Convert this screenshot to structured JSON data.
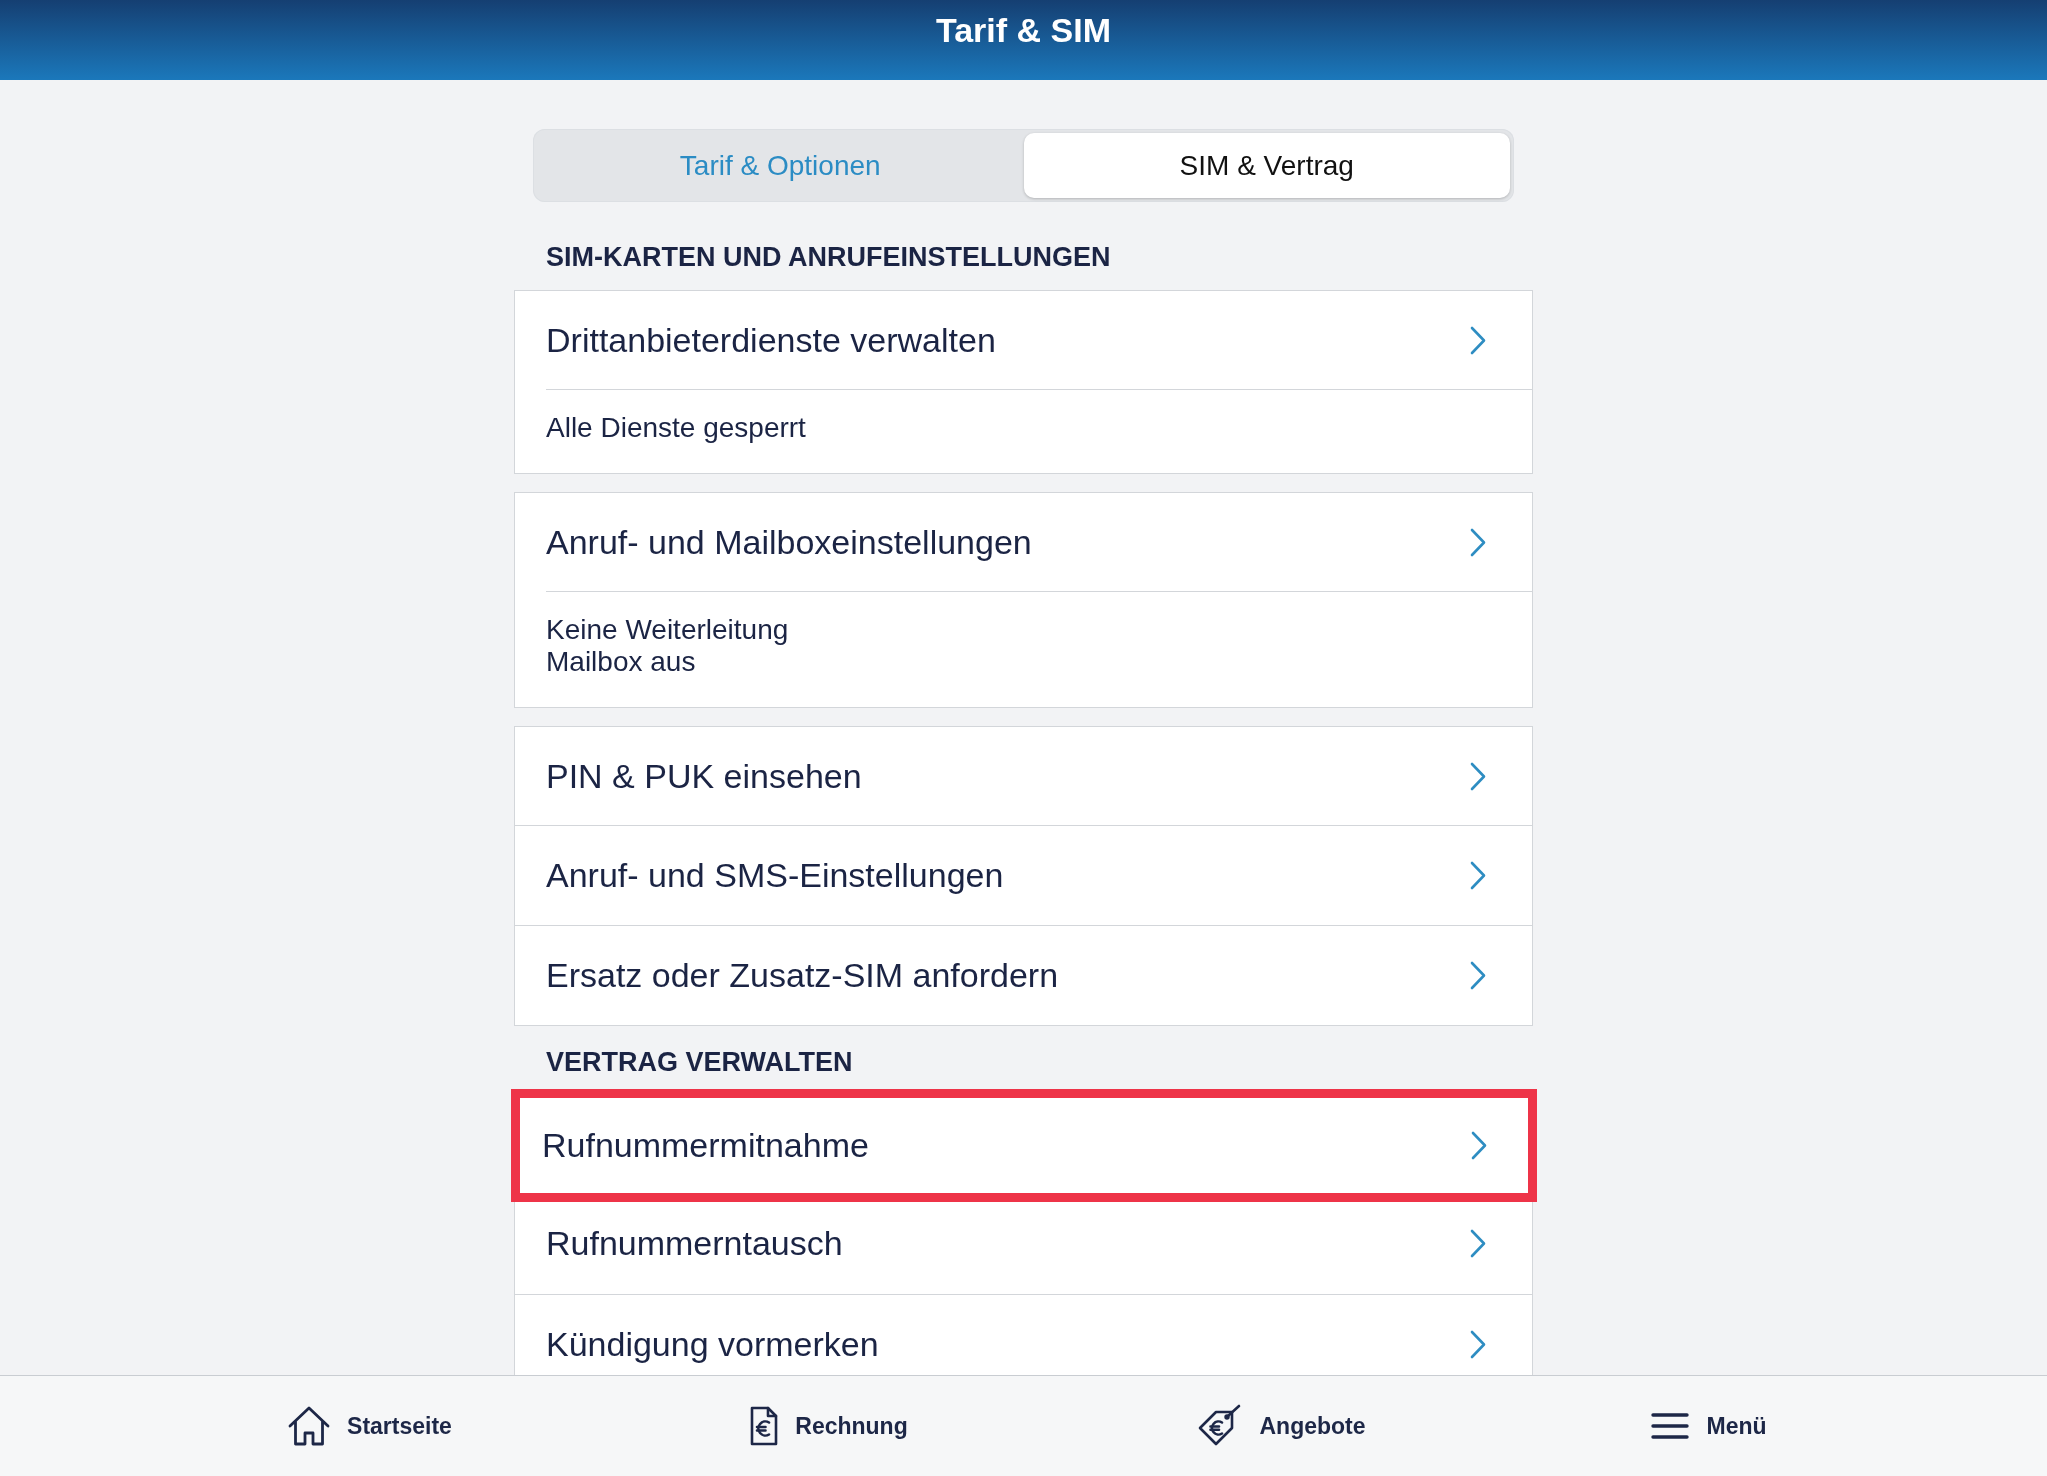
{
  "header": {
    "title": "Tarif & SIM"
  },
  "tabs": [
    {
      "label": "Tarif & Optionen",
      "selected": false
    },
    {
      "label": "SIM & Vertrag",
      "selected": true
    }
  ],
  "sections": [
    {
      "title": "SIM-KARTEN UND ANRUFEINSTELLUNGEN",
      "cards": [
        {
          "items": [
            {
              "label": "Drittanbieterdienste verwalten",
              "highlighted": false
            }
          ],
          "details": [
            "Alle Dienste gesperrt"
          ]
        },
        {
          "items": [
            {
              "label": "Anruf- und Mailboxeinstellungen",
              "highlighted": false
            }
          ],
          "details": [
            "Keine Weiterleitung",
            "Mailbox aus"
          ]
        },
        {
          "items": [
            {
              "label": "PIN & PUK einsehen",
              "highlighted": false
            },
            {
              "label": "Anruf- und SMS-Einstellungen",
              "highlighted": false
            },
            {
              "label": "Ersatz oder Zusatz-SIM anfordern",
              "highlighted": false
            }
          ]
        }
      ]
    },
    {
      "title": "VERTRAG VERWALTEN",
      "cards": [
        {
          "items": [
            {
              "label": "Rufnummermitnahme",
              "highlighted": true
            },
            {
              "label": "Rufnummerntausch",
              "highlighted": false
            },
            {
              "label": "Kündigung vormerken",
              "highlighted": false
            }
          ]
        }
      ]
    }
  ],
  "tab_bar": [
    {
      "kind": "home",
      "label": "Startseite"
    },
    {
      "kind": "invoice",
      "label": "Rechnung"
    },
    {
      "kind": "offers",
      "label": "Angebote"
    },
    {
      "kind": "menu",
      "label": "Menü"
    }
  ]
}
